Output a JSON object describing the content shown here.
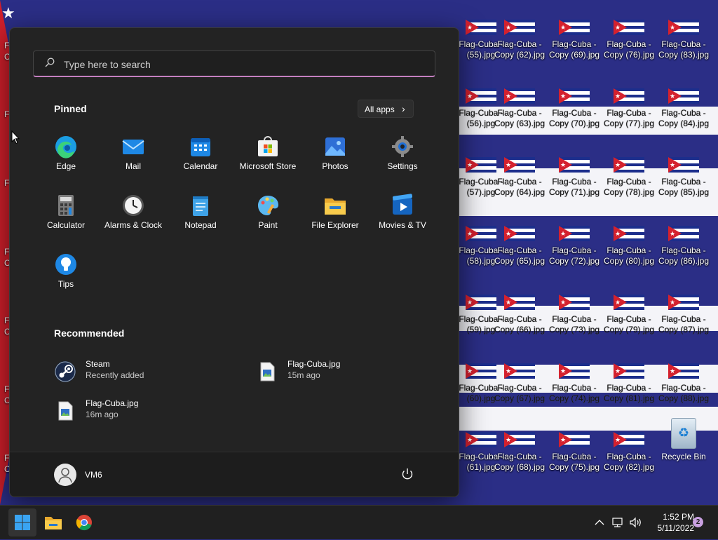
{
  "desktop": {
    "icons": [
      {
        "label1": "Flag-Cuba -",
        "label2": "(55).jpg"
      },
      {
        "label1": "Flag-Cuba -",
        "label2": "Copy (62).jpg"
      },
      {
        "label1": "Flag-Cuba -",
        "label2": "Copy (69).jpg"
      },
      {
        "label1": "Flag-Cuba -",
        "label2": "Copy (76).jpg"
      },
      {
        "label1": "Flag-Cuba -",
        "label2": "Copy (83).jpg"
      },
      {
        "label1": "Flag-Cuba -",
        "label2": "(56).jpg"
      },
      {
        "label1": "Flag-Cuba -",
        "label2": "Copy (63).jpg"
      },
      {
        "label1": "Flag-Cuba -",
        "label2": "Copy (70).jpg"
      },
      {
        "label1": "Flag-Cuba -",
        "label2": "Copy (77).jpg"
      },
      {
        "label1": "Flag-Cuba -",
        "label2": "Copy (84).jpg"
      },
      {
        "label1": "Flag-Cuba -",
        "label2": "(57).jpg"
      },
      {
        "label1": "Flag-Cuba -",
        "label2": "Copy (64).jpg"
      },
      {
        "label1": "Flag-Cuba -",
        "label2": "Copy (71).jpg"
      },
      {
        "label1": "Flag-Cuba -",
        "label2": "Copy (78).jpg"
      },
      {
        "label1": "Flag-Cuba -",
        "label2": "Copy (85).jpg"
      },
      {
        "label1": "Flag-Cuba -",
        "label2": "(58).jpg"
      },
      {
        "label1": "Flag-Cuba -",
        "label2": "Copy (65).jpg"
      },
      {
        "label1": "Flag-Cuba -",
        "label2": "Copy (72).jpg"
      },
      {
        "label1": "Flag-Cuba -",
        "label2": "Copy (80).jpg"
      },
      {
        "label1": "Flag-Cuba -",
        "label2": "Copy (86).jpg"
      },
      {
        "label1": "Flag-Cuba -",
        "label2": "(59).jpg"
      },
      {
        "label1": "Flag-Cuba -",
        "label2": "Copy (66).jpg"
      },
      {
        "label1": "Flag-Cuba -",
        "label2": "Copy (73).jpg"
      },
      {
        "label1": "Flag-Cuba -",
        "label2": "Copy (79).jpg"
      },
      {
        "label1": "Flag-Cuba -",
        "label2": "Copy (87).jpg"
      },
      {
        "label1": "Flag-Cuba -",
        "label2": "(60).jpg"
      },
      {
        "label1": "Flag-Cuba -",
        "label2": "Copy (67).jpg"
      },
      {
        "label1": "Flag-Cuba -",
        "label2": "Copy (74).jpg"
      },
      {
        "label1": "Flag-Cuba -",
        "label2": "Copy (81).jpg"
      },
      {
        "label1": "Flag-Cuba -",
        "label2": "Copy (88).jpg"
      },
      {
        "label1": "Flag-Cuba -",
        "label2": "(61).jpg"
      },
      {
        "label1": "Flag-Cuba -",
        "label2": "Copy (68).jpg"
      },
      {
        "label1": "Flag-Cuba -",
        "label2": "Copy (75).jpg"
      },
      {
        "label1": "Flag-Cuba -",
        "label2": "Copy (82).jpg"
      }
    ],
    "left_edge_labels": [
      "F",
      "C",
      "F",
      "F",
      "F",
      "C",
      "F",
      "C",
      "F",
      "C",
      "F",
      "C"
    ],
    "recycle_bin": "Recycle Bin"
  },
  "start_menu": {
    "search_placeholder": "Type here to search",
    "pinned_title": "Pinned",
    "all_apps": "All apps",
    "pinned": [
      {
        "name": "Edge",
        "icon": "edge-icon"
      },
      {
        "name": "Mail",
        "icon": "mail-icon"
      },
      {
        "name": "Calendar",
        "icon": "calendar-icon"
      },
      {
        "name": "Microsoft Store",
        "icon": "store-icon"
      },
      {
        "name": "Photos",
        "icon": "photos-icon"
      },
      {
        "name": "Settings",
        "icon": "settings-icon"
      },
      {
        "name": "Calculator",
        "icon": "calculator-icon"
      },
      {
        "name": "Alarms & Clock",
        "icon": "clock-icon"
      },
      {
        "name": "Notepad",
        "icon": "notepad-icon"
      },
      {
        "name": "Paint",
        "icon": "paint-icon"
      },
      {
        "name": "File Explorer",
        "icon": "folder-icon"
      },
      {
        "name": "Movies & TV",
        "icon": "movies-icon"
      },
      {
        "name": "Tips",
        "icon": "tips-icon"
      }
    ],
    "recommended_title": "Recommended",
    "recommended": [
      {
        "name": "Steam",
        "sub": "Recently added",
        "icon": "steam-icon"
      },
      {
        "name": "Flag-Cuba.jpg",
        "sub": "15m ago",
        "icon": "image-file-icon"
      },
      {
        "name": "Flag-Cuba.jpg",
        "sub": "16m ago",
        "icon": "image-file-icon"
      }
    ],
    "user": "VM6"
  },
  "taskbar": {
    "time": "1:52 PM",
    "date": "5/11/2022",
    "notifications": "2"
  },
  "colors": {
    "accent": "#c47fc0",
    "menu_bg": "#232323",
    "taskbar_bg": "#202020",
    "flag_blue": "#1c2e8c",
    "flag_red": "#d4212e"
  }
}
